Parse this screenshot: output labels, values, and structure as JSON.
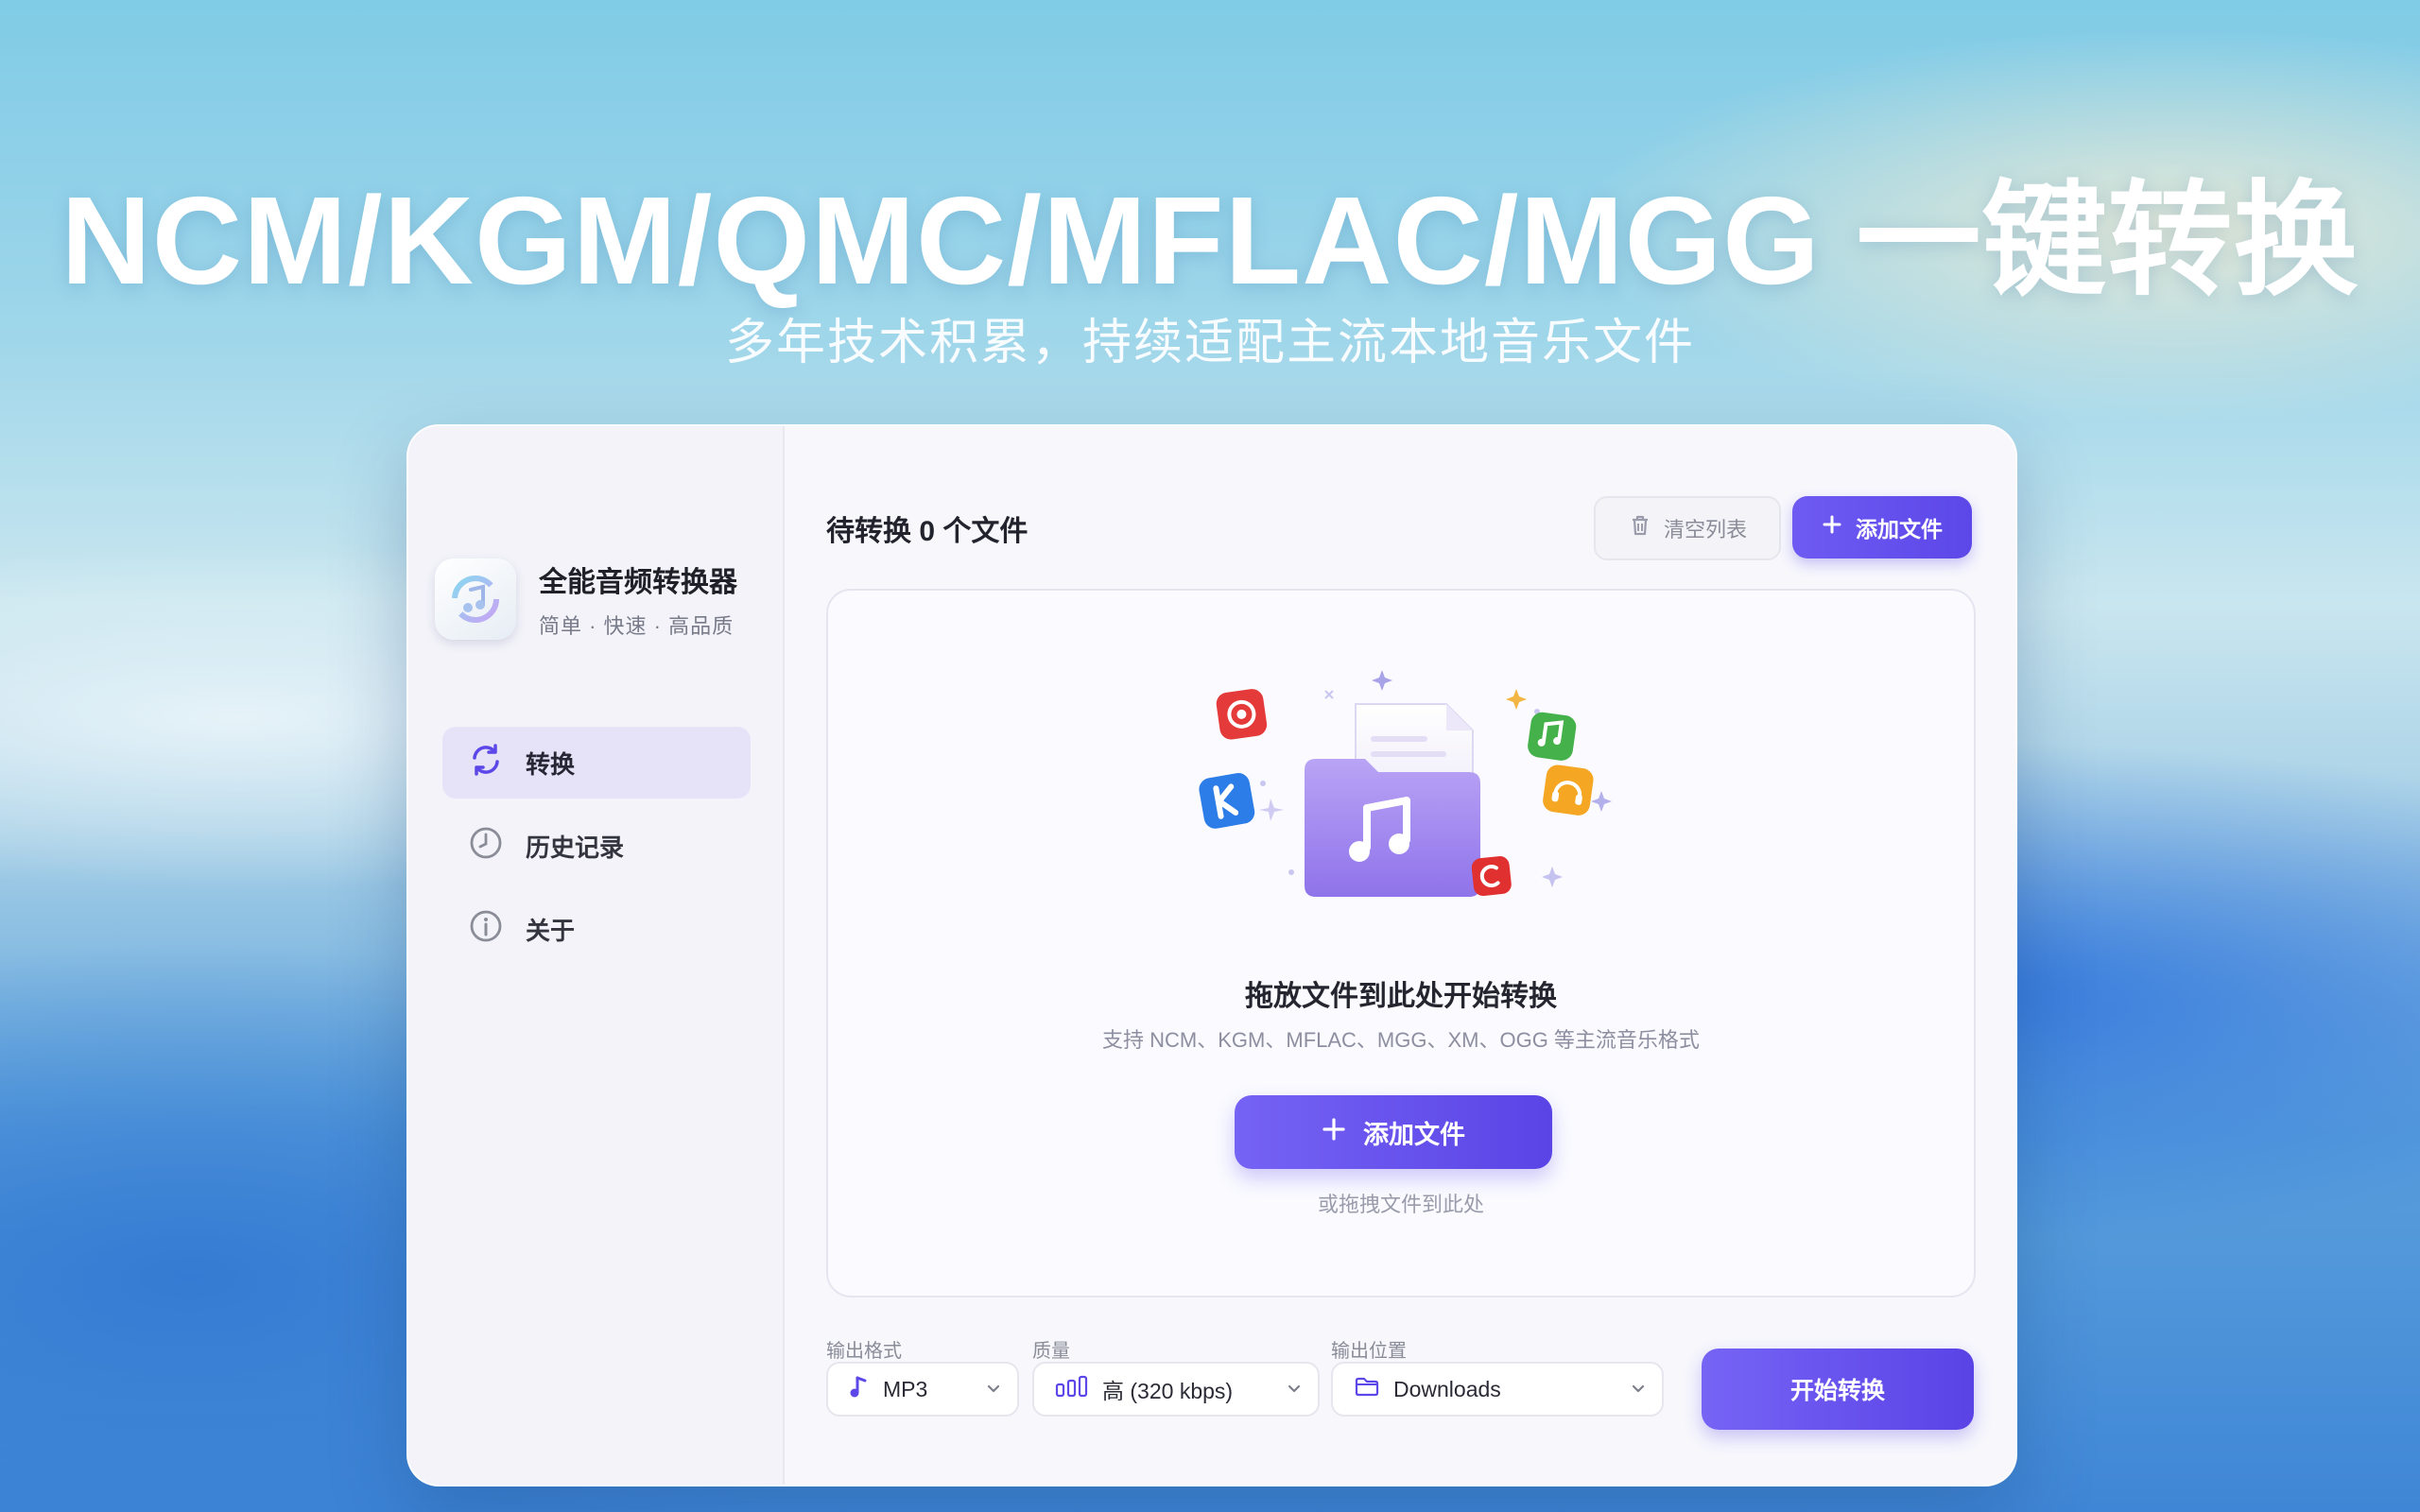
{
  "hero": {
    "title": "NCM/KGM/QMC/MFLAC/MGG 一键转换",
    "subtitle": "多年技术积累，持续适配主流本地音乐文件"
  },
  "window": {
    "traffic_lights": [
      "red",
      "yellow"
    ]
  },
  "sidebar": {
    "app_name": "全能音频转换器",
    "app_tagline": "简单 · 快速 · 高品质",
    "items": [
      {
        "label": "转换",
        "icon": "sync-icon",
        "active": true
      },
      {
        "label": "历史记录",
        "icon": "clock-icon",
        "active": false
      },
      {
        "label": "关于",
        "icon": "info-icon",
        "active": false
      }
    ]
  },
  "main": {
    "title": "待转换 0 个文件",
    "clear_label": "清空列表",
    "add_label": "添加文件",
    "dropzone": {
      "title": "拖放文件到此处开始转换",
      "subtitle": "支持 NCM、KGM、MFLAC、MGG、XM、OGG 等主流音乐格式",
      "button_label": "添加文件",
      "hint": "或拖拽文件到此处"
    },
    "format": {
      "label": "输出格式",
      "value": "MP3"
    },
    "quality": {
      "label": "质量",
      "value": "高 (320 kbps)"
    },
    "output": {
      "label": "输出位置",
      "value": "Downloads"
    },
    "start_label": "开始转换"
  },
  "colors": {
    "accent": "#5c47e8",
    "accent_light": "#e6e3f8"
  }
}
